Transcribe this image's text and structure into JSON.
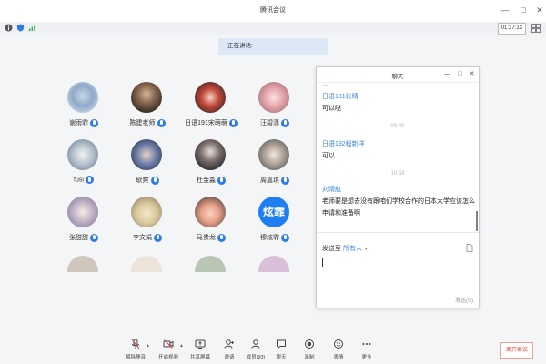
{
  "window": {
    "title": "腾讯会议",
    "controls": {
      "minimize": "—",
      "maximize": "□",
      "close": "✕"
    }
  },
  "status": {
    "timer": "01:37:13",
    "icons": [
      "info-icon",
      "shield-icon",
      "signal-icon"
    ]
  },
  "speaking": {
    "label": "正在讲话:"
  },
  "participants": [
    {
      "name": "谢雨霏",
      "mic": true,
      "avatar": "photo"
    },
    {
      "name": "陈建老师",
      "mic": true,
      "avatar": "photo"
    },
    {
      "name": "日语191宋萌萌",
      "mic": true,
      "avatar": "photo"
    },
    {
      "name": "汪碧潇",
      "mic": true,
      "avatar": "photo"
    },
    {
      "name": "fusi",
      "mic": true,
      "avatar": "photo"
    },
    {
      "name": "耿爽",
      "mic": true,
      "avatar": "photo"
    },
    {
      "name": "杜金淼",
      "mic": true,
      "avatar": "photo"
    },
    {
      "name": "周嘉琪",
      "mic": true,
      "avatar": "photo"
    },
    {
      "name": "张甜甜",
      "mic": true,
      "avatar": "photo"
    },
    {
      "name": "李文娟",
      "mic": true,
      "avatar": "photo"
    },
    {
      "name": "马贵龙",
      "mic": true,
      "avatar": "photo"
    },
    {
      "name": "穆炫霏",
      "mic": true,
      "avatar": "text",
      "avatar_text": "炫霏"
    }
  ],
  "chat": {
    "title": "聊天",
    "messages": [
      {
        "sender": "日语181张晴",
        "text": "可以哒"
      },
      {
        "time": "09:40"
      },
      {
        "sender": "日语192程新洋",
        "text": "可以"
      },
      {
        "time": "10:58"
      },
      {
        "sender": "刘晴航",
        "text": "老师要是想去没有跟咱们学校合作的日本大学应该怎么申请和准备啊"
      }
    ],
    "send_to_label": "发送至",
    "send_to_target": "所有人",
    "send_button": "发送(S)"
  },
  "toolbar": {
    "items": [
      {
        "label": "解除静音",
        "icon": "mic-muted-icon"
      },
      {
        "label": "开启视频",
        "icon": "video-off-icon"
      },
      {
        "label": "共享屏幕",
        "icon": "share-screen-icon"
      },
      {
        "label": "邀请",
        "icon": "invite-icon"
      },
      {
        "label": "成员(93)",
        "icon": "members-icon"
      },
      {
        "label": "聊天",
        "icon": "chat-icon"
      },
      {
        "label": "录制",
        "icon": "record-icon"
      },
      {
        "label": "表情",
        "icon": "emoji-icon"
      },
      {
        "label": "更多",
        "icon": "more-icon"
      }
    ],
    "leave": "离开会议"
  },
  "colors": {
    "accent": "#2e7ce6",
    "leave": "#d9463b",
    "link": "#3b86d6"
  }
}
